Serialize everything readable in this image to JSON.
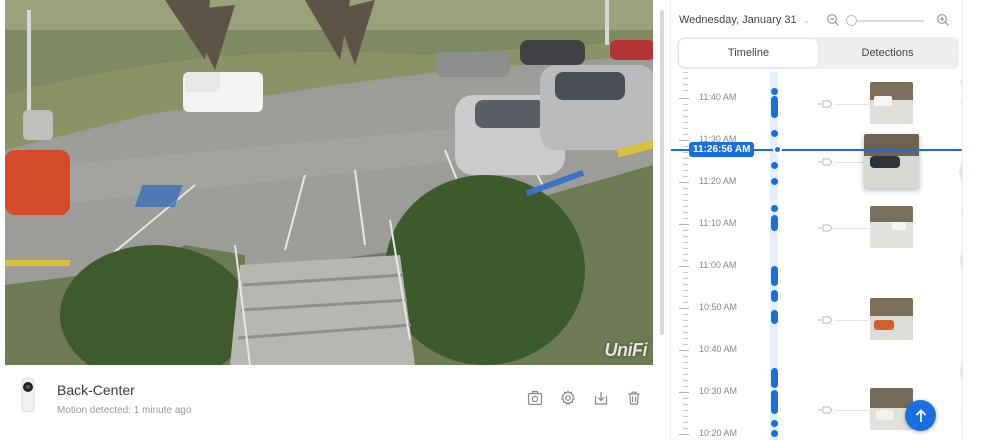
{
  "video": {
    "watermark": "UniFi"
  },
  "camera": {
    "name": "Back-Center",
    "status": "Motion detected: 1 minute ago",
    "actions": [
      {
        "icon": "snapshot-icon"
      },
      {
        "icon": "gear-icon"
      },
      {
        "icon": "download-icon"
      },
      {
        "icon": "trash-icon"
      }
    ]
  },
  "timeline": {
    "date": "Wednesday, January 31",
    "zoom_level": 0.0,
    "tabs": [
      {
        "label": "Timeline",
        "active": true
      },
      {
        "label": "Detections",
        "active": false
      }
    ],
    "current_time": "11:26:56 AM",
    "time_labels": [
      "11:40 AM",
      "11:30 AM",
      "11:20 AM",
      "11:10 AM",
      "11:00 AM",
      "10:50 AM",
      "10:40 AM",
      "10:30 AM",
      "10:20 AM"
    ],
    "colors": {
      "accent": "#1a6fe0",
      "lane": "#e6f0fb"
    }
  }
}
